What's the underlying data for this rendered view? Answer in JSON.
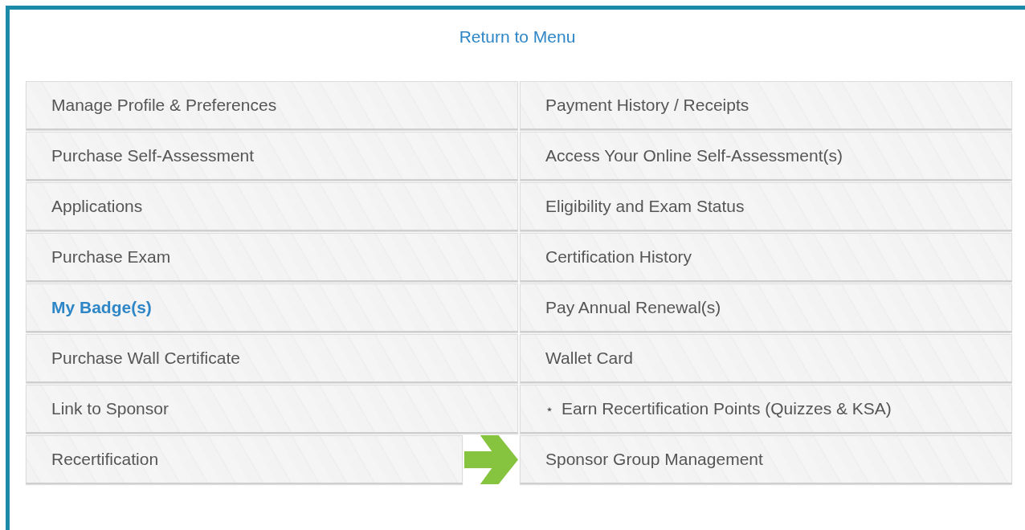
{
  "return_link": "Return to Menu",
  "menu_items": [
    {
      "label": "Manage Profile & Preferences",
      "highlighted": false,
      "pointed": false
    },
    {
      "label": "Payment History / Receipts",
      "highlighted": false,
      "pointed": false
    },
    {
      "label": "Purchase Self-Assessment",
      "highlighted": false,
      "pointed": false
    },
    {
      "label": "Access Your Online Self-Assessment(s)",
      "highlighted": false,
      "pointed": false
    },
    {
      "label": "Applications",
      "highlighted": false,
      "pointed": false
    },
    {
      "label": "Eligibility and Exam Status",
      "highlighted": false,
      "pointed": false
    },
    {
      "label": "Purchase Exam",
      "highlighted": false,
      "pointed": false
    },
    {
      "label": "Certification History",
      "highlighted": false,
      "pointed": false
    },
    {
      "label": "My Badge(s)",
      "highlighted": true,
      "pointed": false
    },
    {
      "label": "Pay Annual Renewal(s)",
      "highlighted": false,
      "pointed": false
    },
    {
      "label": "Purchase Wall Certificate",
      "highlighted": false,
      "pointed": false
    },
    {
      "label": "Wallet Card",
      "highlighted": false,
      "pointed": false
    },
    {
      "label": "Link to Sponsor",
      "highlighted": false,
      "pointed": false
    },
    {
      "label": "Earn Recertification Points (Quizzes & KSA)",
      "prefix": "⋆",
      "highlighted": false,
      "pointed": false
    },
    {
      "label": "Recertification",
      "highlighted": false,
      "pointed": false
    },
    {
      "label": "Sponsor Group Management",
      "highlighted": false,
      "pointed": true
    }
  ]
}
